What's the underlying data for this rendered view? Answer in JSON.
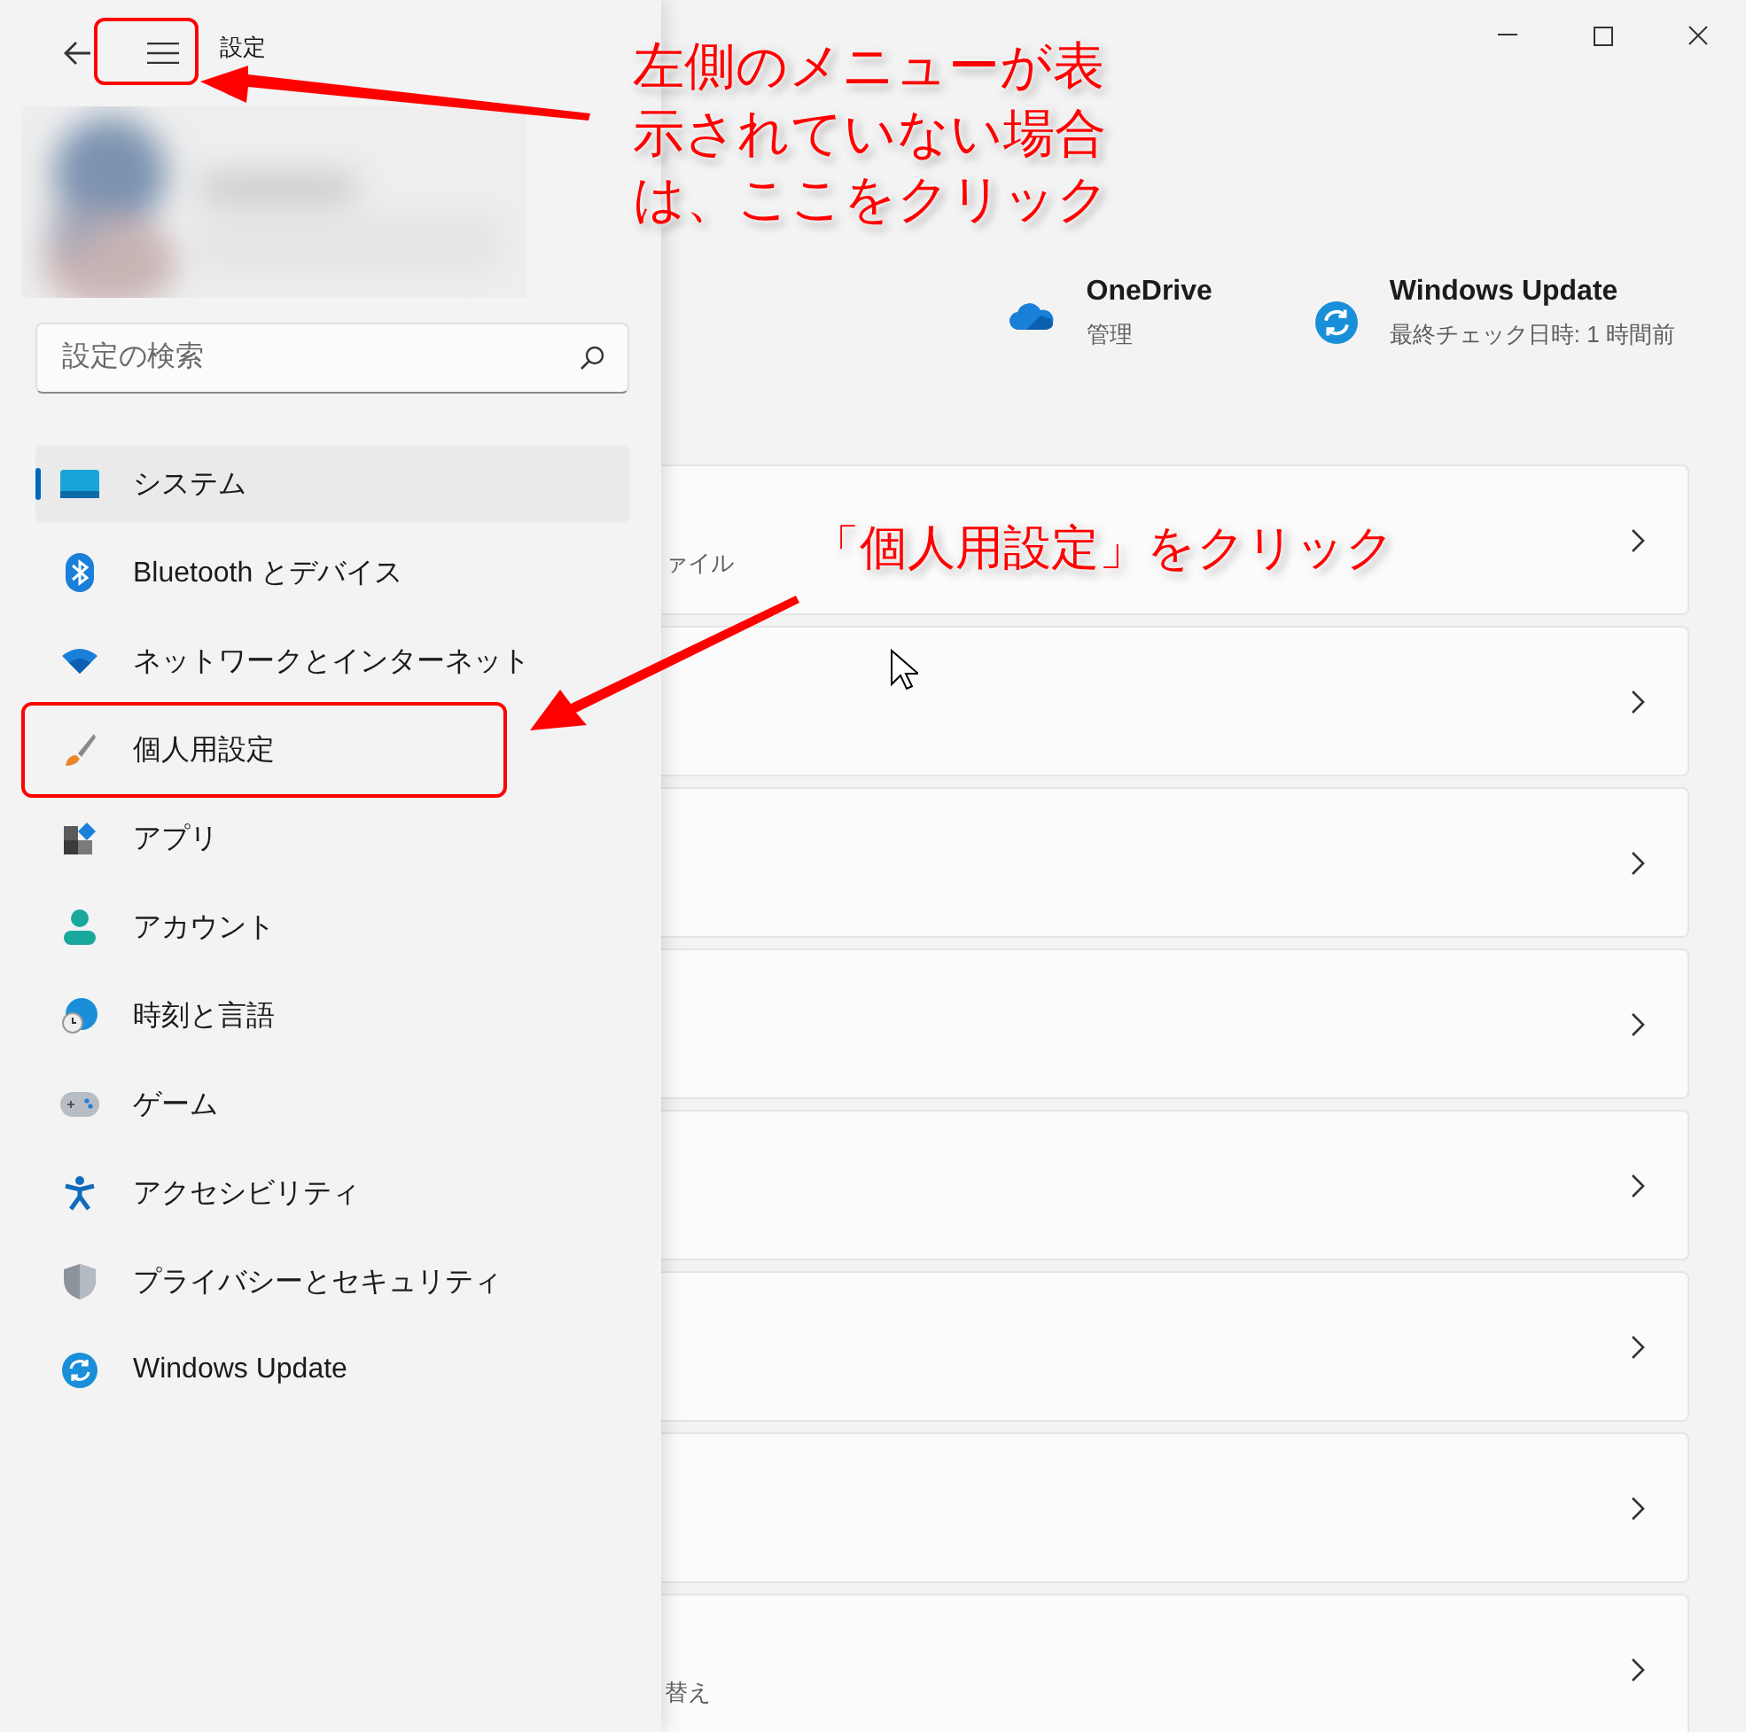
{
  "window": {
    "title": "設定"
  },
  "search": {
    "placeholder": "設定の検索"
  },
  "nav": [
    {
      "label": "システム",
      "selected": true
    },
    {
      "label": "Bluetooth とデバイス",
      "selected": false
    },
    {
      "label": "ネットワークとインターネット",
      "selected": false
    },
    {
      "label": "個人用設定",
      "selected": false
    },
    {
      "label": "アプリ",
      "selected": false
    },
    {
      "label": "アカウント",
      "selected": false
    },
    {
      "label": "時刻と言語",
      "selected": false
    },
    {
      "label": "ゲーム",
      "selected": false
    },
    {
      "label": "アクセシビリティ",
      "selected": false
    },
    {
      "label": "プライバシーとセキュリティ",
      "selected": false
    },
    {
      "label": "Windows Update",
      "selected": false
    }
  ],
  "header": [
    {
      "title": "OneDrive",
      "subtitle": "管理"
    },
    {
      "title": "Windows Update",
      "subtitle": "最終チェック日時: 1 時間前"
    }
  ],
  "cards": [
    {
      "kind": "text",
      "description": "ァイル"
    },
    {
      "kind": "plain"
    },
    {
      "kind": "plain"
    },
    {
      "kind": "plain"
    },
    {
      "kind": "plain"
    },
    {
      "kind": "plain"
    },
    {
      "kind": "plain"
    },
    {
      "kind": "text",
      "description": "替え"
    }
  ],
  "annotations": [
    {
      "kind": "callout",
      "text": "左側のメニューが表示されていない場合は、ここをクリック"
    },
    {
      "kind": "callout",
      "text": "「個人用設定」をクリック"
    }
  ]
}
